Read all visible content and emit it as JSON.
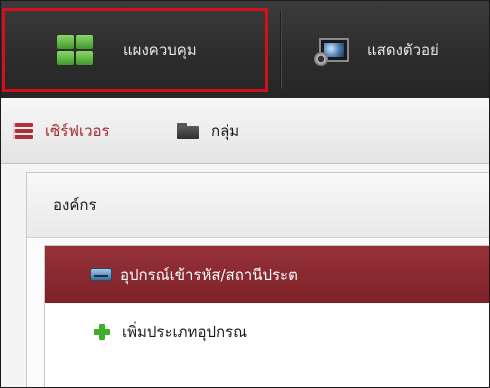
{
  "toolbar": {
    "items": [
      {
        "label": "แผงควบคุม",
        "icon": "control-panel-grid-icon",
        "highlighted": true
      },
      {
        "label": "แสดงตัวอย่",
        "icon": "live-view-monitor-icon"
      }
    ],
    "highlight_color": "#d0101a"
  },
  "tabs": [
    {
      "label": "เซิร์ฟเวอร",
      "icon": "server-icon",
      "active": true
    },
    {
      "label": "กลุ่ม",
      "icon": "folder-icon"
    }
  ],
  "panel": {
    "title": "องค์กร",
    "items": [
      {
        "label": "อุปกรณ์เข้ารหัส/สถานีประต",
        "icon": "encoder-device-icon",
        "selected": true
      },
      {
        "label": "เพิ่มประเภทอุปกรณ",
        "icon": "plus-icon"
      }
    ]
  },
  "colors": {
    "accent": "#953238",
    "toolbar_bg": "#2c2c2c",
    "plus_green": "#3fae2a"
  }
}
